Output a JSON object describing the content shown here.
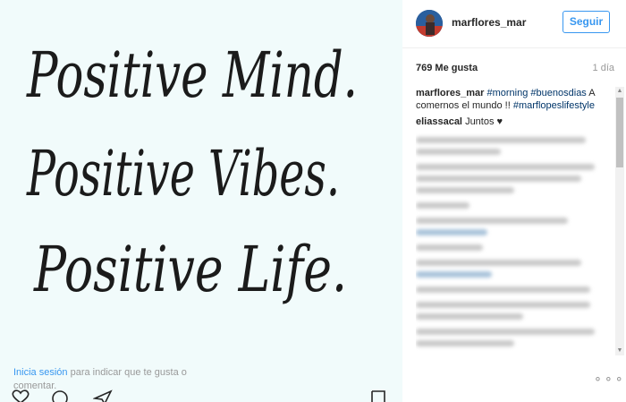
{
  "photo": {
    "lines": [
      "Positive Mind.",
      "Positive Vibes.",
      "Positive Life."
    ],
    "background": "#f1fbfb",
    "ink": "#1b1b1b"
  },
  "actions": {
    "icons": [
      "heart-icon",
      "comment-icon",
      "share-icon",
      "bookmark-icon"
    ]
  },
  "header": {
    "username": "marflores_mar",
    "follow_label": "Seguir"
  },
  "stats": {
    "likes": "769 Me gusta",
    "time": "1 día"
  },
  "caption": {
    "username": "marflores_mar",
    "tag1": "#morning",
    "tag2": "#buenosdias",
    "text1": "A comernos el mundo !!",
    "tag3": "#marflореslifestyle"
  },
  "comments": [
    {
      "username": "eliassacal",
      "text": "Juntos ♥"
    }
  ],
  "footer": {
    "login_link": "Inicia sesión",
    "login_text": "para indicar que te gusta o comentar.",
    "more": "⚬⚬⚬"
  },
  "colors": {
    "accent": "#3897f0",
    "hashtag": "#003569",
    "muted": "#999999"
  }
}
